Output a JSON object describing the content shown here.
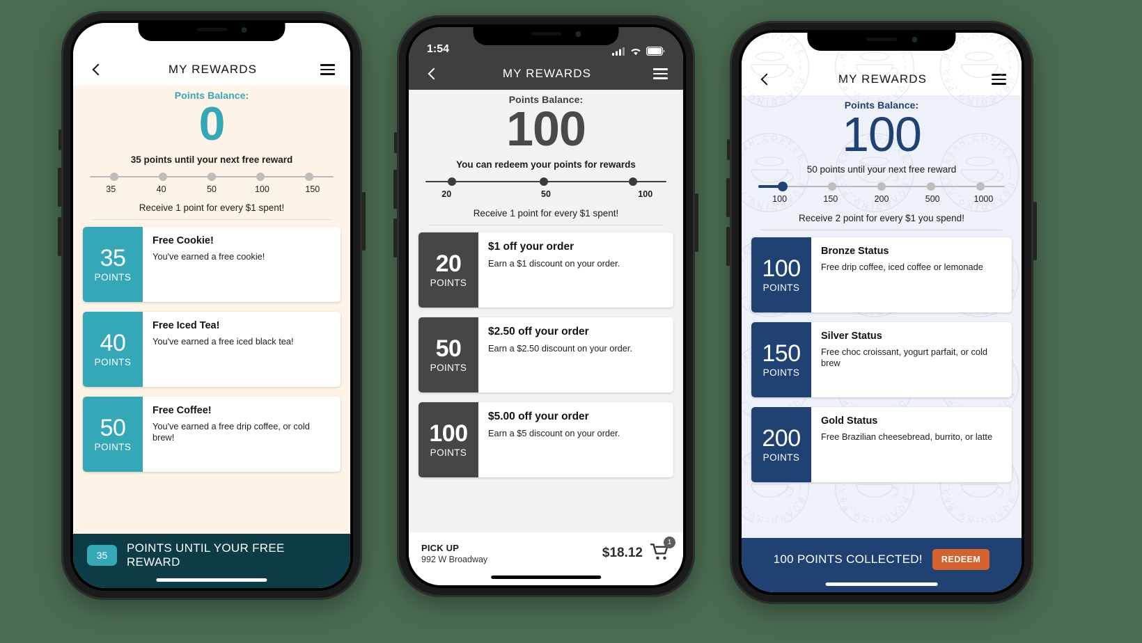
{
  "phones": [
    {
      "id": "phone-teal",
      "theme": {
        "accent": "#35a8b8",
        "bg": "#fdf4e7",
        "bottom_bar": "#0c3c45",
        "nav_bg": "#ffffff",
        "nav_fg": "#111111",
        "balance_color": "#35a8b8"
      },
      "statusbar": {
        "visible": false,
        "time": "",
        "battery": ""
      },
      "nav": {
        "back_icon": "chevron-left-icon",
        "title": "MY REWARDS",
        "menu_icon": "hamburger-menu-icon"
      },
      "hero": {
        "balance_label": "Points Balance:",
        "balance_value": "0",
        "until_message": "35 points until your next free reward",
        "earn_rate": "Receive 1 point for every $1 spent!"
      },
      "slider": {
        "ticks": [
          "35",
          "40",
          "50",
          "100",
          "150"
        ],
        "filled_index": -1,
        "bold_ticks": false
      },
      "rewards": [
        {
          "points": "35",
          "points_unit": "POINTS",
          "title": "Free Cookie!",
          "desc": "You've earned a free cookie!"
        },
        {
          "points": "40",
          "points_unit": "POINTS",
          "title": "Free Iced Tea!",
          "desc": "You've earned a free iced black tea!"
        },
        {
          "points": "50",
          "points_unit": "POINTS",
          "title": "Free Coffee!",
          "desc": "You've earned a free drip coffee, or cold brew!"
        }
      ],
      "bottom": {
        "type": "progress",
        "pill_value": "35",
        "text": "POINTS UNTIL YOUR FREE REWARD"
      }
    },
    {
      "id": "phone-dark",
      "theme": {
        "accent": "#464646",
        "bg": "#f2f2f2",
        "bottom_bar": "#ffffff",
        "nav_bg": "#3f3f3f",
        "nav_fg": "#ffffff",
        "balance_color": "#4a4a4a"
      },
      "statusbar": {
        "visible": true,
        "time": "1:54",
        "signal_icon": "cellular-signal-icon",
        "wifi_icon": "wifi-icon",
        "battery_icon": "battery-icon"
      },
      "nav": {
        "back_icon": "chevron-left-icon",
        "title": "MY REWARDS",
        "menu_icon": "hamburger-menu-icon"
      },
      "hero": {
        "balance_label": "Points Balance:",
        "balance_value": "100",
        "until_message": "You can redeem your points for rewards",
        "earn_rate": "Receive 1 point for every $1 spent!"
      },
      "slider": {
        "ticks": [
          "20",
          "50",
          "100"
        ],
        "filled_index": -1,
        "bold_ticks": true
      },
      "rewards": [
        {
          "points": "20",
          "points_unit": "POINTS",
          "title": "$1 off your order",
          "desc": "Earn a $1 discount on your order."
        },
        {
          "points": "50",
          "points_unit": "POINTS",
          "title": "$2.50 off your order",
          "desc": "Earn a $2.50 discount on your order."
        },
        {
          "points": "100",
          "points_unit": "POINTS",
          "title": "$5.00 off your order",
          "desc": "Earn a $5 discount on your order."
        }
      ],
      "bottom": {
        "type": "checkout",
        "pickup_label": "PICK UP",
        "pickup_address": "992 W Broadway",
        "total": "$18.12",
        "cart_icon": "shopping-cart-icon",
        "cart_count": "1"
      }
    },
    {
      "id": "phone-navy",
      "theme": {
        "accent": "#204272",
        "bg": "#eef1f7",
        "bottom_bar": "#204272",
        "nav_bg": "#ffffff",
        "nav_fg": "#111111",
        "balance_color": "#204272",
        "redeem_bg": "#d5622c"
      },
      "statusbar": {
        "visible": false,
        "time": "",
        "battery": ""
      },
      "nav": {
        "back_icon": "chevron-left-icon",
        "title": "MY REWARDS",
        "menu_icon": "hamburger-menu-icon"
      },
      "hero": {
        "balance_label": "Points Balance:",
        "balance_value": "100",
        "until_message": "50 points until your next free reward",
        "earn_rate": "Receive 2 point for every $1 you spend!"
      },
      "slider": {
        "ticks": [
          "100",
          "150",
          "200",
          "500",
          "1000"
        ],
        "filled_index": 0,
        "bold_ticks": false
      },
      "watermark_text": "B84H COFFEE BOARDING PASS",
      "rewards": [
        {
          "points": "100",
          "points_unit": "POINTS",
          "title": "Bronze Status",
          "desc": "Free drip coffee, iced coffee or lemonade"
        },
        {
          "points": "150",
          "points_unit": "POINTS",
          "title": "Silver Status",
          "desc": "Free choc croissant, yogurt parfait, or cold brew"
        },
        {
          "points": "200",
          "points_unit": "POINTS",
          "title": "Gold Status",
          "desc": "Free Brazilian cheesebread, burrito, or latte"
        }
      ],
      "bottom": {
        "type": "collected",
        "text": "100 POINTS COLLECTED!",
        "button_label": "REDEEM"
      }
    }
  ]
}
